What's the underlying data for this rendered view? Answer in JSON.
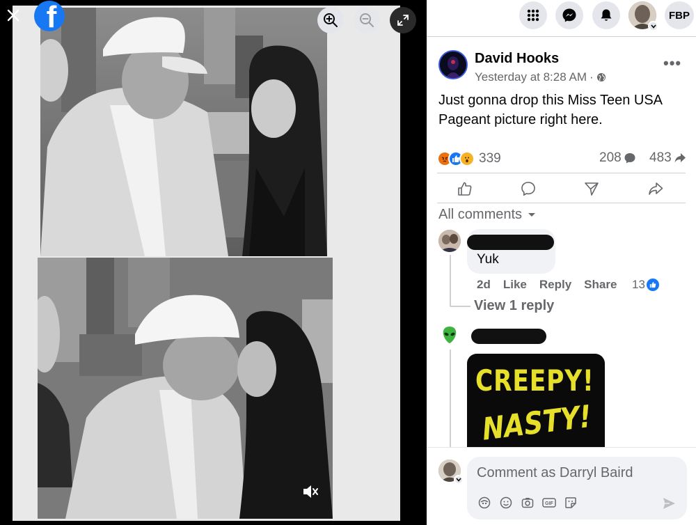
{
  "viewer": {
    "icons": [
      "close-icon",
      "facebook-logo",
      "zoom-in-icon",
      "zoom-out-icon",
      "fullscreen-icon",
      "mute-icon"
    ],
    "logo_letter": "f"
  },
  "topbar": {
    "icons": [
      "menu-grid-icon",
      "messenger-icon",
      "bell-icon",
      "account-chevron-icon"
    ],
    "page_badge": "FBP"
  },
  "post": {
    "author": "David Hooks",
    "timestamp": "Yesterday at 8:28 AM",
    "separator": "·",
    "privacy_icon": "globe-icon",
    "more": "•••",
    "text": "Just gonna drop this Miss Teen USA Pageant picture right here.",
    "reaction_count": "339",
    "reaction_icons": [
      "angry-reaction",
      "like-reaction",
      "wow-reaction"
    ],
    "comment_count": "208",
    "share_count": "483",
    "actions": [
      "like-icon",
      "comment-icon",
      "send-icon",
      "share-icon"
    ]
  },
  "comments": {
    "filter_label": "All comments",
    "items": [
      {
        "text": "Yuk",
        "age": "2d",
        "like_label": "Like",
        "reply_label": "Reply",
        "share_label": "Share",
        "likes": "13",
        "view_replies": "View 1 reply"
      },
      {
        "image_text_1": "CREEPY!",
        "image_text_2": "NASTY!"
      }
    ]
  },
  "composer": {
    "placeholder": "Comment as Darryl Baird",
    "icons": [
      "avatar-sticker-icon",
      "emoji-icon",
      "camera-icon",
      "gif-icon",
      "sticker-icon"
    ],
    "gif_label": "GIF",
    "send_icon": "send-icon"
  },
  "colors": {
    "facebook_blue": "#1877f2",
    "secondary_text": "#65676b",
    "bubble": "#f0f2f5",
    "creepy_yellow": "#e6e02a"
  }
}
